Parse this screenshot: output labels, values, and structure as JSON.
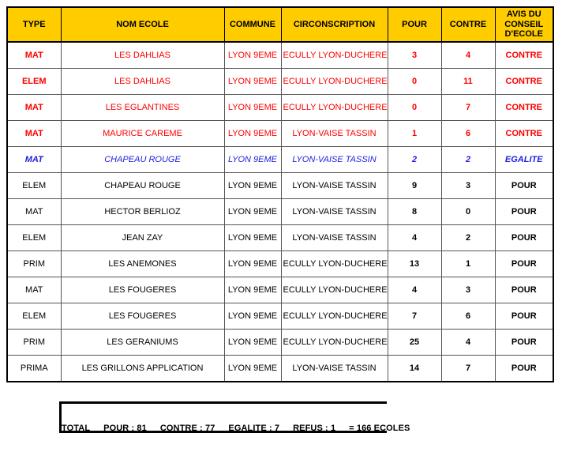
{
  "table": {
    "columns": [
      {
        "key": "type",
        "label": "TYPE"
      },
      {
        "key": "nom",
        "label": "NOM ECOLE"
      },
      {
        "key": "commune",
        "label": "COMMUNE"
      },
      {
        "key": "circ",
        "label": "CIRCONSCRIPTION"
      },
      {
        "key": "pour",
        "label": "POUR"
      },
      {
        "key": "contre",
        "label": "CONTRE"
      },
      {
        "key": "avis",
        "label": "AVIS DU CONSEIL D'ECOLE"
      }
    ],
    "avis_header_lines": [
      "AVIS DU",
      "CONSEIL",
      "D'ECOLE"
    ],
    "rows": [
      {
        "type": "MAT",
        "nom": "LES DAHLIAS",
        "commune": "LYON 9EME",
        "circ": "ECULLY LYON-DUCHERE",
        "pour": "3",
        "contre": "4",
        "avis": "CONTRE",
        "style": "contre"
      },
      {
        "type": "ELEM",
        "nom": "LES DAHLIAS",
        "commune": "LYON 9EME",
        "circ": "ECULLY LYON-DUCHERE",
        "pour": "0",
        "contre": "11",
        "avis": "CONTRE",
        "style": "contre"
      },
      {
        "type": "MAT",
        "nom": "LES EGLANTINES",
        "commune": "LYON 9EME",
        "circ": "ECULLY LYON-DUCHERE",
        "pour": "0",
        "contre": "7",
        "avis": "CONTRE",
        "style": "contre"
      },
      {
        "type": "MAT",
        "nom": "MAURICE CAREME",
        "commune": "LYON 9EME",
        "circ": "LYON-VAISE TASSIN",
        "pour": "1",
        "contre": "6",
        "avis": "CONTRE",
        "style": "contre"
      },
      {
        "type": "MAT",
        "nom": "CHAPEAU ROUGE",
        "commune": "LYON 9EME",
        "circ": "LYON-VAISE TASSIN",
        "pour": "2",
        "contre": "2",
        "avis": "EGALITE",
        "style": "egalite"
      },
      {
        "type": "ELEM",
        "nom": "CHAPEAU ROUGE",
        "commune": "LYON 9EME",
        "circ": "LYON-VAISE TASSIN",
        "pour": "9",
        "contre": "3",
        "avis": "POUR",
        "style": "pour"
      },
      {
        "type": "MAT",
        "nom": "HECTOR BERLIOZ",
        "commune": "LYON 9EME",
        "circ": "LYON-VAISE TASSIN",
        "pour": "8",
        "contre": "0",
        "avis": "POUR",
        "style": "pour"
      },
      {
        "type": "ELEM",
        "nom": "JEAN ZAY",
        "commune": "LYON 9EME",
        "circ": "LYON-VAISE TASSIN",
        "pour": "4",
        "contre": "2",
        "avis": "POUR",
        "style": "pour"
      },
      {
        "type": "PRIM",
        "nom": "LES ANEMONES",
        "commune": "LYON 9EME",
        "circ": "ECULLY LYON-DUCHERE",
        "pour": "13",
        "contre": "1",
        "avis": "POUR",
        "style": "pour"
      },
      {
        "type": "MAT",
        "nom": "LES FOUGERES",
        "commune": "LYON 9EME",
        "circ": "ECULLY LYON-DUCHERE",
        "pour": "4",
        "contre": "3",
        "avis": "POUR",
        "style": "pour"
      },
      {
        "type": "ELEM",
        "nom": "LES FOUGERES",
        "commune": "LYON 9EME",
        "circ": "ECULLY LYON-DUCHERE",
        "pour": "7",
        "contre": "6",
        "avis": "POUR",
        "style": "pour"
      },
      {
        "type": "PRIM",
        "nom": "LES GERANIUMS",
        "commune": "LYON 9EME",
        "circ": "ECULLY LYON-DUCHERE",
        "pour": "25",
        "contre": "4",
        "avis": "POUR",
        "style": "pour"
      },
      {
        "type": "PRIMA",
        "nom": "LES GRILLONS APPLICATION",
        "commune": "LYON 9EME",
        "circ": "LYON-VAISE TASSIN",
        "pour": "14",
        "contre": "7",
        "avis": "POUR",
        "style": "pour"
      }
    ]
  },
  "summary": {
    "total_label": "TOTAL",
    "pour": "POUR : 81",
    "contre": "CONTRE : 77",
    "egalite": "EGALITE : 7",
    "refus": "REFUS : 1",
    "result": "= 166 ECOLES"
  },
  "colors": {
    "header_background": "#FFCC00",
    "contre_text": "#FE0000",
    "egalite_text": "#2020DD",
    "pour_text": "#000000",
    "border": "#000000"
  }
}
